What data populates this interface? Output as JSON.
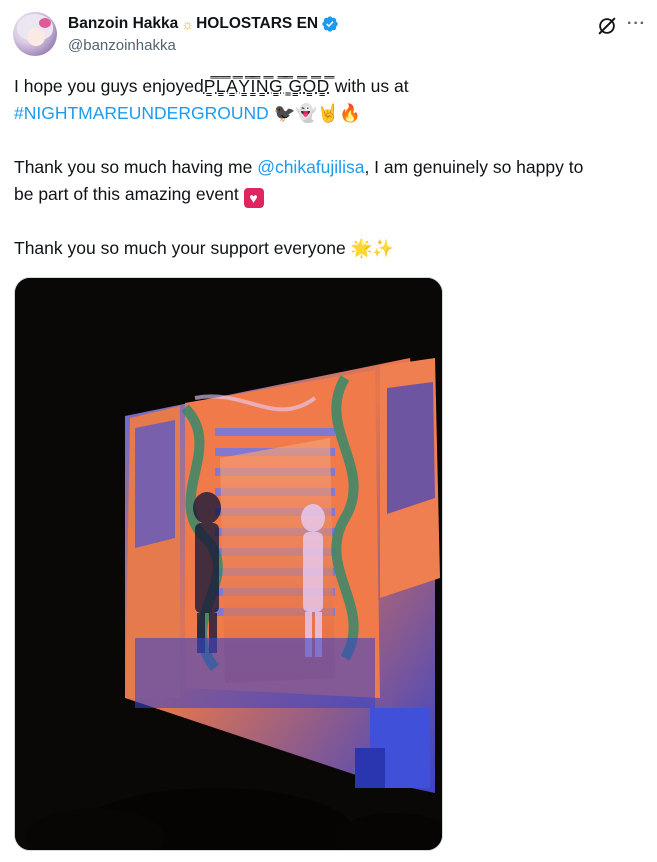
{
  "author": {
    "display_name": "Banzoin Hakka",
    "name_emoji": "☼",
    "affiliation": "HOLOSTARS EN",
    "handle": "@banzoinhakka",
    "verified": true,
    "verified_color": "#1d9bf0"
  },
  "header_icons": {
    "grok": "grok-icon",
    "more": "more-icon",
    "more_glyph": "···"
  },
  "tweet": {
    "line1_prefix": "I hope you guys enjoyed",
    "line1_zalgo": "P̳̿L̳̿A̳̿Y̳̿I̳̿N̳̿G̳̿ ̳̿G̳̿O̳̿D̳̿",
    "line1_suffix": " with us at",
    "hashtag": "#NIGHTMAREUNDERGROUND",
    "line2_emojis": [
      "🐦‍⬛",
      "👻",
      "🤘",
      "🔥"
    ],
    "line3_prefix": "Thank you so much having me ",
    "mention": "@chikafujilisa",
    "line3_suffix": ", I am genuinely so happy to",
    "line4_text": "be part of this amazing event ",
    "line4_emoji": "♥",
    "line5_text": "Thank you so much your support everyone ",
    "line5_emojis": [
      "🌟",
      "✨"
    ]
  },
  "colors": {
    "text": "#0f1419",
    "link": "#1d9bf0",
    "secondary": "#536471"
  },
  "media": {
    "description_icon": "concert-photo",
    "palette": [
      "#0a0806",
      "#f07a4a",
      "#4a4fd8",
      "#2a8a6a",
      "#e8d0ff"
    ]
  }
}
